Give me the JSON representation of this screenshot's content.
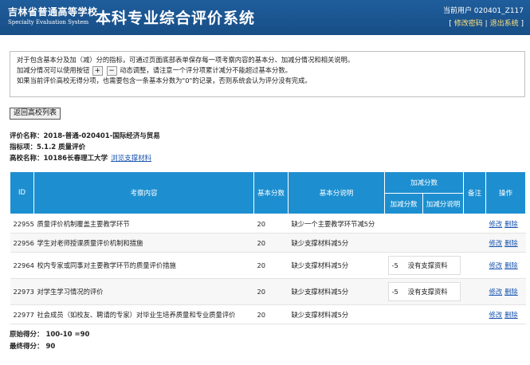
{
  "header": {
    "school_cn": "吉林省普通高等学校",
    "school_en": "Specialty Evaluation System",
    "title": "本科专业综合评价系统",
    "user_label": "当前用户 020401_Z117",
    "bracket_open": "[",
    "change_pw": "修改密码",
    "separator": "|",
    "logout": "退出系统",
    "bracket_close": "]"
  },
  "notice": {
    "line1": "对于包含基本分及加（减）分的指标，可通过页面底部表单保存每一项考察内容的基本分、加减分情况和相关说明。",
    "line2_a": "加减分情况可以使用按钮",
    "plus": "+",
    "minus": "−",
    "line2_b": "动态调整，请注意一个评分项累计减分不能超过基本分数。",
    "line3": "如果当前评价高校无得分项，也需要包含一条基本分数为\"0\"的记录，否则系统会认为评分没有完成。"
  },
  "back_button": "返回高校列表",
  "info": {
    "name_label": "评价名称：",
    "name_value": "2018-普通-020401-国际经济与贸易",
    "indicator_label": "指标项：",
    "indicator_value": "5.1.2 质量评价",
    "school_label": "高校名称：",
    "school_value": "10186长春理工大学",
    "browse_link": "浏览支撑材料"
  },
  "table": {
    "headers": {
      "id": "ID",
      "content": "考察内容",
      "base": "基本分数",
      "base_desc": "基本分说明",
      "add_group": "加减分数",
      "add_score": "加减分数",
      "add_desc": "加减分说明",
      "note": "备注",
      "ops": "操作"
    },
    "rows": [
      {
        "id": "22955",
        "content": "质量评价机制覆盖主要教学环节",
        "base": "20",
        "desc": "缺少一个主要教学环节减5分",
        "add": "",
        "add_desc": "",
        "edit": "修改",
        "del": "删除"
      },
      {
        "id": "22956",
        "content": "学生对老师授课质量评价机制和措施",
        "base": "20",
        "desc": "缺少支撑材料减5分",
        "add": "",
        "add_desc": "",
        "edit": "修改",
        "del": "删除"
      },
      {
        "id": "22964",
        "content": "校内专家或同事对主要教学环节的质量评价措施",
        "base": "20",
        "desc": "缺少支撑材料减5分",
        "add": "-5",
        "add_desc": "没有支撑资料",
        "edit": "修改",
        "del": "删除"
      },
      {
        "id": "22973",
        "content": "对学生学习情况的评价",
        "base": "20",
        "desc": "缺少支撑材料减5分",
        "add": "-5",
        "add_desc": "没有支撑资料",
        "edit": "修改",
        "del": "删除"
      },
      {
        "id": "22977",
        "content": "社会成员（如校友、聘请的专家）对毕业生培养质量和专业质量评价",
        "base": "20",
        "desc": "缺少支撑材料减5分",
        "add": "",
        "add_desc": "",
        "edit": "修改",
        "del": "删除"
      }
    ]
  },
  "scores": {
    "original": "原始得分：  100-10 =90",
    "final": "最终得分：  90"
  }
}
